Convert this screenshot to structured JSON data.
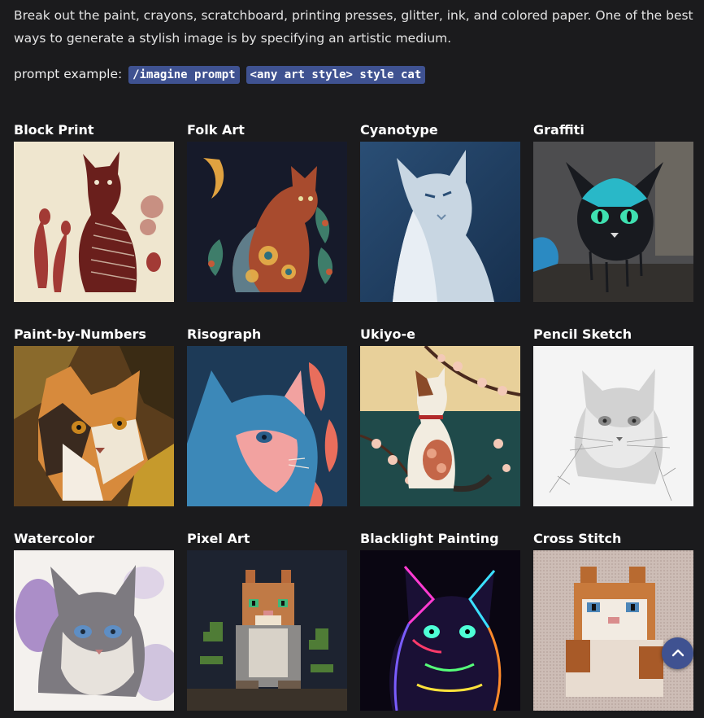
{
  "intro": {
    "text": "Break out the paint, crayons, scratchboard, printing presses, glitter, ink, and colored paper. One of the best ways to generate a stylish image is by specifying an artistic medium."
  },
  "prompt": {
    "label": "prompt example:",
    "code1": "/imagine prompt",
    "code2": "<any art style> style cat"
  },
  "styles": [
    {
      "title": "Block Print"
    },
    {
      "title": "Folk Art"
    },
    {
      "title": "Cyanotype"
    },
    {
      "title": "Graffiti"
    },
    {
      "title": "Paint-by-Numbers"
    },
    {
      "title": "Risograph"
    },
    {
      "title": "Ukiyo-e"
    },
    {
      "title": "Pencil Sketch"
    },
    {
      "title": "Watercolor"
    },
    {
      "title": "Pixel Art"
    },
    {
      "title": "Blacklight Painting"
    },
    {
      "title": "Cross Stitch"
    }
  ],
  "colors": {
    "background": "#1b1b1d",
    "accent": "#3f5291"
  },
  "icons": {
    "scroll_top": "arrow-up-icon"
  }
}
